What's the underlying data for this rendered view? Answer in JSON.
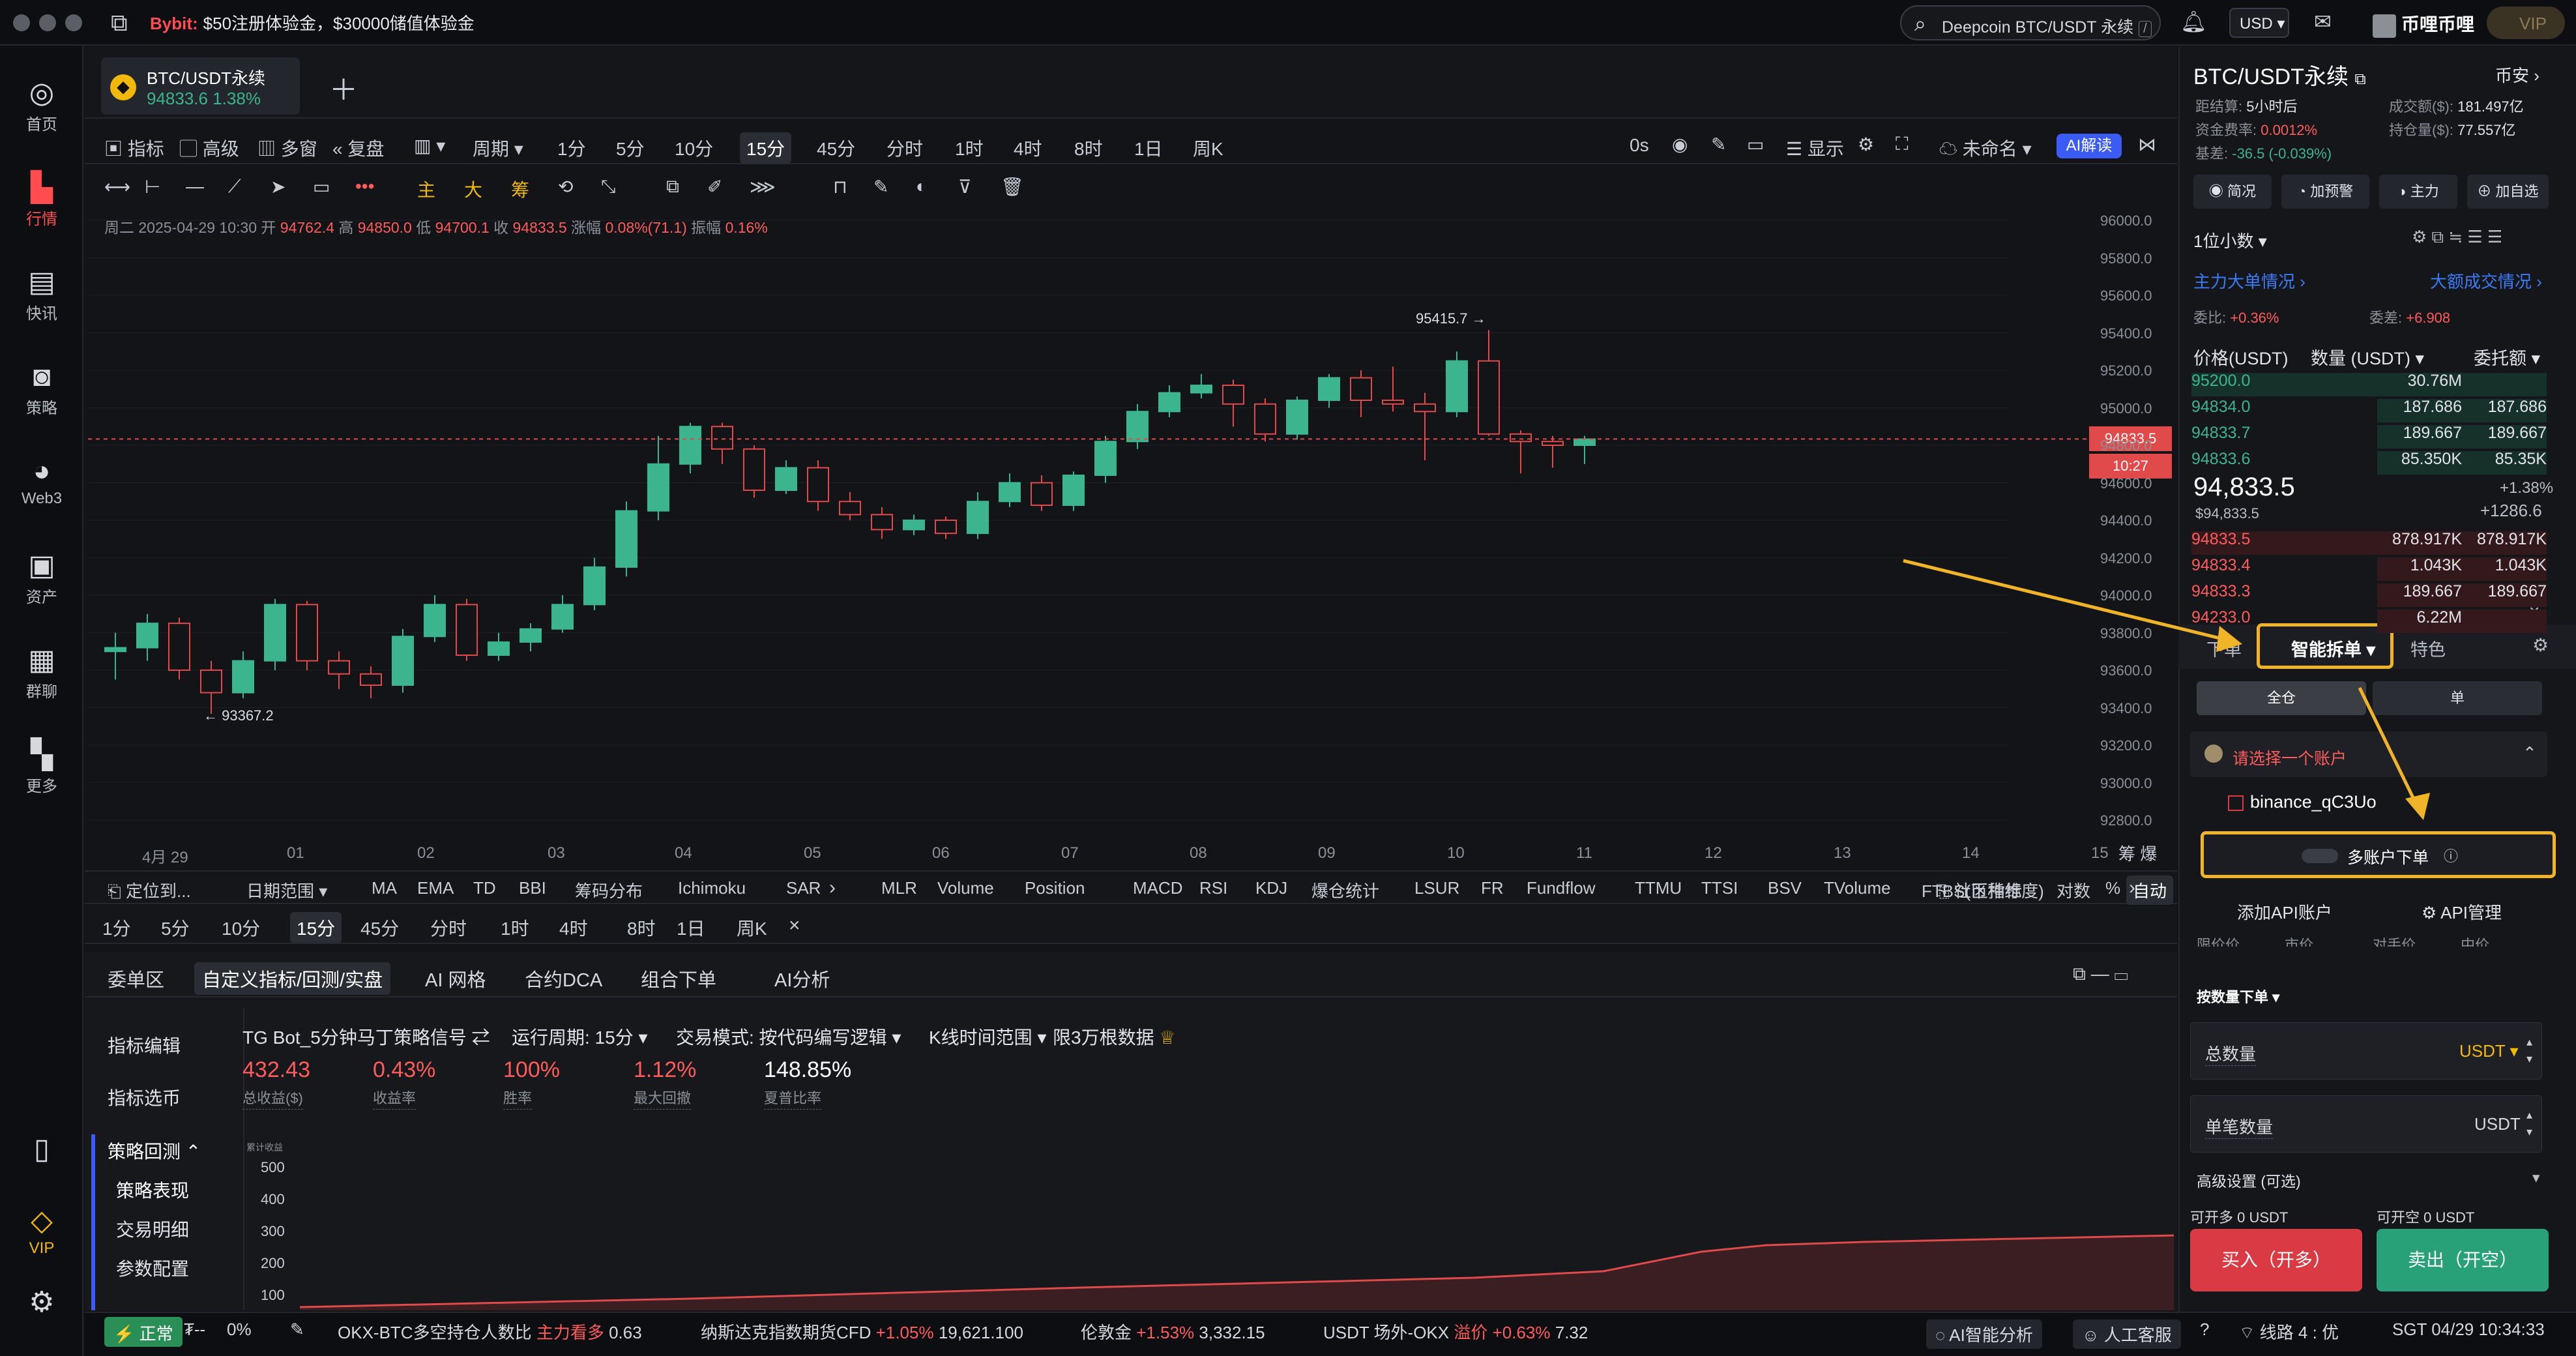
{
  "topbar": {
    "promo_brand": "Bybit:",
    "promo_text": "$50注册体验金，$30000储值体验金",
    "search_placeholder": "Deepcoin BTC/USDT 永续",
    "search_key": "/",
    "currency": "USD",
    "user": "币哩币哩",
    "vip": "VIP"
  },
  "nav": [
    {
      "label": "首页",
      "icon": "home-icon"
    },
    {
      "label": "行情",
      "icon": "market-icon"
    },
    {
      "label": "快讯",
      "icon": "news-icon"
    },
    {
      "label": "策略",
      "icon": "strategy-icon"
    },
    {
      "label": "Web3",
      "icon": "web3-icon"
    },
    {
      "label": "资产",
      "icon": "wallet-icon"
    },
    {
      "label": "群聊",
      "icon": "chat-icon"
    },
    {
      "label": "更多",
      "icon": "more-icon"
    },
    {
      "label": "VIP",
      "icon": "vip-icon"
    }
  ],
  "tab": {
    "symbol": "BTC/USDT永续",
    "price": "94833.6",
    "change": "1.38%"
  },
  "toolbar": {
    "indicator": "指标",
    "advanced": "高级",
    "multi": "多窗",
    "replay": "复盘",
    "period": "周期",
    "intervals": [
      "1分",
      "5分",
      "10分",
      "15分",
      "45分",
      "分时",
      "1时",
      "4时",
      "8时",
      "1日",
      "周K"
    ],
    "active": "15分",
    "countdown": "0s",
    "display": "显示",
    "unnamed": "未命名",
    "ai": "AI解读"
  },
  "drawtools": {
    "zhu": "主",
    "da": "大",
    "chou": "筹"
  },
  "ohlc": {
    "date": "周二 2025-04-29 10:30",
    "open_label": "开",
    "open": "94762.4",
    "high_label": "高",
    "high": "94850.0",
    "low_label": "低",
    "low": "94700.1",
    "close_label": "收",
    "close": "94833.5",
    "chg_label": "涨幅",
    "chg": "0.08%(71.1)",
    "amp_label": "振幅",
    "amp": "0.16%"
  },
  "chart_data": {
    "type": "candlestick",
    "symbol": "BTC/USDT永续",
    "interval": "15分",
    "ylim": [
      92800,
      96000
    ],
    "yticks": [
      "96000.0",
      "95800.0",
      "95600.0",
      "95400.0",
      "95200.0",
      "95000.0",
      "94800.0",
      "94600.0",
      "94400.0",
      "94200.0",
      "94000.0",
      "93800.0",
      "93600.0",
      "93400.0",
      "93200.0",
      "93000.0",
      "92800.0"
    ],
    "xticks": [
      "4月 29",
      "01",
      "02",
      "03",
      "04",
      "05",
      "06",
      "07",
      "08",
      "09",
      "10",
      "11",
      "12",
      "13",
      "14",
      "15"
    ],
    "high_label": "95415.7",
    "low_label": "93367.2",
    "last_price": "94833.5",
    "last_time": "10:27",
    "candles": [
      [
        93700,
        93720,
        93550,
        93800
      ],
      [
        93720,
        93850,
        93650,
        93900
      ],
      [
        93850,
        93600,
        93550,
        93880
      ],
      [
        93600,
        93480,
        93367,
        93650
      ],
      [
        93480,
        93650,
        93450,
        93700
      ],
      [
        93650,
        93950,
        93600,
        93980
      ],
      [
        93950,
        93650,
        93600,
        93970
      ],
      [
        93650,
        93580,
        93500,
        93700
      ],
      [
        93580,
        93520,
        93450,
        93620
      ],
      [
        93520,
        93780,
        93480,
        93820
      ],
      [
        93780,
        93950,
        93750,
        94000
      ],
      [
        93950,
        93680,
        93650,
        93980
      ],
      [
        93680,
        93750,
        93650,
        93800
      ],
      [
        93750,
        93820,
        93700,
        93850
      ],
      [
        93820,
        93950,
        93800,
        94000
      ],
      [
        93950,
        94150,
        93920,
        94200
      ],
      [
        94150,
        94450,
        94100,
        94500
      ],
      [
        94450,
        94700,
        94400,
        94850
      ],
      [
        94700,
        94900,
        94650,
        94920
      ],
      [
        94900,
        94780,
        94700,
        94920
      ],
      [
        94780,
        94560,
        94520,
        94800
      ],
      [
        94560,
        94680,
        94540,
        94720
      ],
      [
        94680,
        94500,
        94450,
        94720
      ],
      [
        94500,
        94430,
        94400,
        94550
      ],
      [
        94430,
        94350,
        94300,
        94470
      ],
      [
        94350,
        94400,
        94320,
        94430
      ],
      [
        94400,
        94330,
        94300,
        94420
      ],
      [
        94330,
        94500,
        94300,
        94550
      ],
      [
        94500,
        94600,
        94470,
        94650
      ],
      [
        94600,
        94480,
        94450,
        94640
      ],
      [
        94480,
        94640,
        94450,
        94660
      ],
      [
        94640,
        94820,
        94600,
        94850
      ],
      [
        94820,
        94980,
        94780,
        95020
      ],
      [
        94980,
        95080,
        94950,
        95120
      ],
      [
        95080,
        95120,
        95050,
        95180
      ],
      [
        95120,
        95020,
        94900,
        95150
      ],
      [
        95020,
        94860,
        94820,
        95050
      ],
      [
        94860,
        95040,
        94830,
        95060
      ],
      [
        95040,
        95160,
        95000,
        95180
      ],
      [
        95160,
        95040,
        94950,
        95200
      ],
      [
        95040,
        95020,
        94980,
        95220
      ],
      [
        95020,
        94980,
        94720,
        95080
      ],
      [
        94980,
        95250,
        94950,
        95300
      ],
      [
        95250,
        94860,
        94850,
        95415
      ],
      [
        94860,
        94820,
        94650,
        94880
      ],
      [
        94820,
        94800,
        94680,
        94850
      ],
      [
        94800,
        94833,
        94700,
        94850
      ]
    ]
  },
  "indicators": {
    "locate": "定位到...",
    "range": "日期范围",
    "list": [
      "MA",
      "EMA",
      "TD",
      "BBI",
      "筹码分布",
      "Ichimoku",
      "SAR",
      "MLR",
      "Volume",
      "Position",
      "MACD",
      "RSI",
      "KDJ",
      "爆仓统计",
      "LSUR",
      "FR",
      "Fundflow",
      "TTMU",
      "TTSI",
      "BSV",
      "TVolume",
      "FTBS(币种维度)"
    ],
    "community": "社区指标",
    "log": "对数",
    "pct": "%",
    "auto": "自动"
  },
  "sub_intervals": [
    "1分",
    "5分",
    "10分",
    "15分",
    "45分",
    "分时",
    "1时",
    "4时",
    "8时",
    "1日",
    "周K"
  ],
  "bottom": {
    "tabs": [
      "委单区",
      "自定义指标/回测/实盘",
      "AI 网格",
      "合约DCA",
      "组合下单",
      "AI分析"
    ],
    "active": "自定义指标/回测/实盘",
    "side": [
      "指标编辑",
      "指标选币",
      "策略回测",
      "策略表现",
      "交易明细",
      "参数配置"
    ],
    "strategy": "TG Bot_5分钟马丁策略信号",
    "cycle": "运行周期: 15分",
    "mode": "交易模式: 按代码编写逻辑",
    "range": "K线时间范围",
    "limit": "限3万根数据",
    "stats": [
      {
        "value": "432.43",
        "label": "总收益($)",
        "color": "#ff5b5b"
      },
      {
        "value": "0.43%",
        "label": "收益率",
        "color": "#ff5b5b"
      },
      {
        "value": "100%",
        "label": "胜率",
        "color": "#ff5b5b"
      },
      {
        "value": "1.12%",
        "label": "最大回撤",
        "color": "#ff5b5b"
      },
      {
        "value": "148.85%",
        "label": "夏普比率",
        "color": "#ffffff"
      }
    ],
    "ychart_label": "累计收益",
    "yticks": [
      "500",
      "400",
      "300",
      "200",
      "100"
    ]
  },
  "ticker": {
    "status": "正常",
    "ping": "₮--",
    "pct": "0%",
    "okx_label": "OKX-BTC多空持仓人数比",
    "okx_tag": "主力看多",
    "okx_val": "0.63",
    "ndx_label": "纳斯达克指数期货CFD",
    "ndx_chg": "+1.05%",
    "ndx_val": "19,621.100",
    "gold_label": "伦敦金",
    "gold_chg": "+1.53%",
    "gold_val": "3,332.15",
    "usdt_label": "USDT 场外-OKX",
    "usdt_tag": "溢价",
    "usdt_chg": "+0.63%",
    "usdt_val": "7.32",
    "ai": "AI智能分析",
    "service": "人工客服",
    "line": "线路 4 : 优",
    "time": "SGT 04/29 10:34:33"
  },
  "right": {
    "title": "BTC/USDT永续",
    "exchange": "币安",
    "settle_label": "距结算:",
    "settle": "5小时后",
    "vol_label": "成交额($):",
    "vol": "181.497亿",
    "fund_label": "资金费率:",
    "fund": "0.0012%",
    "oi_label": "持仓量($):",
    "oi": "77.557亿",
    "basis_label": "基差:",
    "basis": "-36.5 (-0.039%)",
    "btns": [
      "简况",
      "加预警",
      "主力",
      "加自选"
    ],
    "decimals": "1位小数",
    "big_order": "主力大单情况",
    "big_trade": "大额成交情况",
    "wb_label": "委比:",
    "wb": "+0.36%",
    "wc_label": "委差:",
    "wc": "+6.908",
    "col_price": "价格(USDT)",
    "col_qty": "数量 (USDT)",
    "col_total": "委托额",
    "asks": [
      {
        "p": "95200.0",
        "q": "30.76M",
        "t": ""
      },
      {
        "p": "94834.0",
        "q": "187.686",
        "t": "187.686"
      },
      {
        "p": "94833.7",
        "q": "189.667",
        "t": "189.667"
      },
      {
        "p": "94833.6",
        "q": "85.350K",
        "t": "85.35K"
      }
    ],
    "last": "94,833.5",
    "last_usd": "$94,833.5",
    "last_pct": "+1.38%",
    "last_chg": "+1286.6",
    "bids": [
      {
        "p": "94833.5",
        "q": "878.917K",
        "t": "878.917K"
      },
      {
        "p": "94833.4",
        "q": "1.043K",
        "t": "1.043K"
      },
      {
        "p": "94833.3",
        "q": "189.667",
        "t": "189.667"
      },
      {
        "p": "94233.0",
        "q": "6.22M",
        "t": ""
      }
    ],
    "order_tabs": [
      "下单",
      "智能拆单",
      "特色"
    ],
    "margin": [
      "全仓",
      "单"
    ],
    "account_select": "请选择一个账户",
    "account": "binance_qC3Uo",
    "multi_acc": "多账户下单",
    "add_api": "添加API账户",
    "api_mgr": "API管理",
    "types": [
      "限价价",
      "市价",
      "对手价",
      "中价"
    ],
    "by_qty": "按数量下单",
    "total_qty": "总数量",
    "unit": "USDT",
    "single_qty": "单笔数量",
    "adv": "高级设置 (可选)",
    "can_long": "可开多 0 USDT",
    "can_short": "可开空 0 USDT",
    "buy": "买入（开多）",
    "sell": "卖出（开空）"
  }
}
